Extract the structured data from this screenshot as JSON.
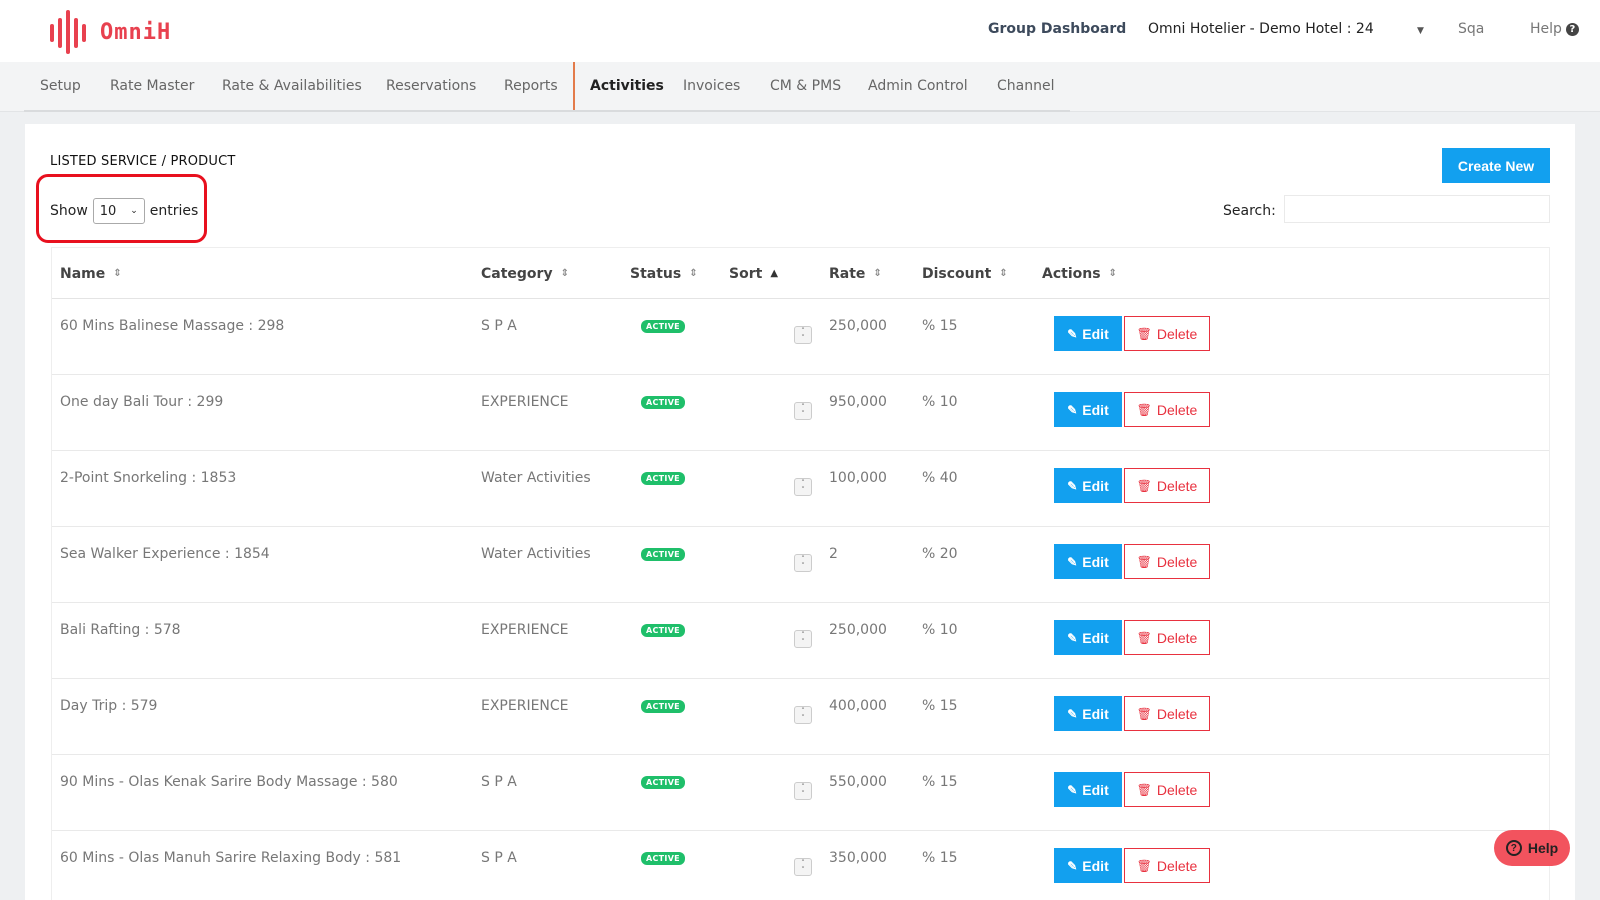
{
  "header": {
    "logo_text": "OmniH",
    "group_dashboard": "Group Dashboard",
    "hotel_selector": "Omni Hotelier - Demo Hotel : 24",
    "user": "Sqa",
    "help": "Help",
    "brand_color": "#e8414f"
  },
  "nav": {
    "items": [
      "Setup",
      "Rate Master",
      "Rate & Availabilities",
      "Reservations",
      "Reports",
      "Activities",
      "Invoices",
      "CM & PMS",
      "Admin Control",
      "Channel"
    ],
    "active": "Activities"
  },
  "page": {
    "title": "LISTED SERVICE / PRODUCT",
    "create_button": "Create New",
    "show_label": "Show",
    "show_value": "10",
    "entries_label": "entries",
    "search_label": "Search:",
    "search_value": ""
  },
  "table": {
    "columns": [
      "Name",
      "Category",
      "Status",
      "Sort",
      "Rate",
      "Discount",
      "Actions"
    ],
    "edit_label": "Edit",
    "delete_label": "Delete",
    "rows": [
      {
        "name": "60 Mins Balinese Massage : 298",
        "category": "S P A",
        "status": "ACTIVE",
        "rate": "250,000",
        "discount": "% 15"
      },
      {
        "name": "One day Bali Tour : 299",
        "category": "EXPERIENCE",
        "status": "ACTIVE",
        "rate": "950,000",
        "discount": "% 10"
      },
      {
        "name": "2-Point Snorkeling : 1853",
        "category": "Water Activities",
        "status": "ACTIVE",
        "rate": "100,000",
        "discount": "% 40"
      },
      {
        "name": "Sea Walker Experience : 1854",
        "category": "Water Activities",
        "status": "ACTIVE",
        "rate": "2",
        "discount": "% 20"
      },
      {
        "name": "Bali Rafting : 578",
        "category": "EXPERIENCE",
        "status": "ACTIVE",
        "rate": "250,000",
        "discount": "% 10"
      },
      {
        "name": "Day Trip : 579",
        "category": "EXPERIENCE",
        "status": "ACTIVE",
        "rate": "400,000",
        "discount": "% 15"
      },
      {
        "name": "90 Mins - Olas Kenak Sarire Body Massage : 580",
        "category": "S P A",
        "status": "ACTIVE",
        "rate": "550,000",
        "discount": "% 15"
      },
      {
        "name": "60 Mins - Olas Manuh Sarire Relaxing Body : 581",
        "category": "S P A",
        "status": "ACTIVE",
        "rate": "350,000",
        "discount": "% 15"
      }
    ]
  },
  "floating_help": {
    "label": "Help"
  },
  "colors": {
    "primary": "#12a0ef",
    "danger": "#e8313f",
    "success": "#1fbf6a",
    "highlight": "#e8101e"
  }
}
